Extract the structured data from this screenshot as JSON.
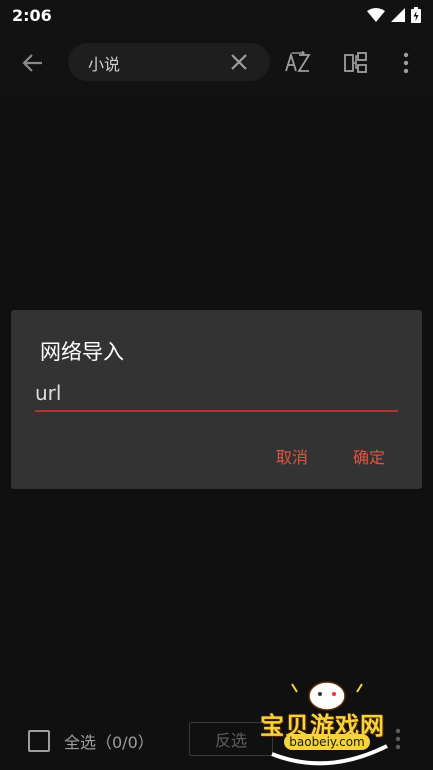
{
  "status_bar": {
    "time": "2:06"
  },
  "search": {
    "value": "小说"
  },
  "dialog": {
    "title": "网络导入",
    "input_value": "url",
    "cancel_label": "取消",
    "confirm_label": "确定",
    "accent_color": "#e0553f"
  },
  "bottom": {
    "select_all_label": "全选（0/0）",
    "invert_label": "反选"
  },
  "watermark": {
    "text": "宝贝游戏网",
    "url": "baobeiy.com"
  },
  "icons": {
    "back": "arrow-left-icon",
    "clear": "close-icon",
    "sort": "sort-az-icon",
    "group": "group-icon",
    "more": "more-vert-icon"
  }
}
